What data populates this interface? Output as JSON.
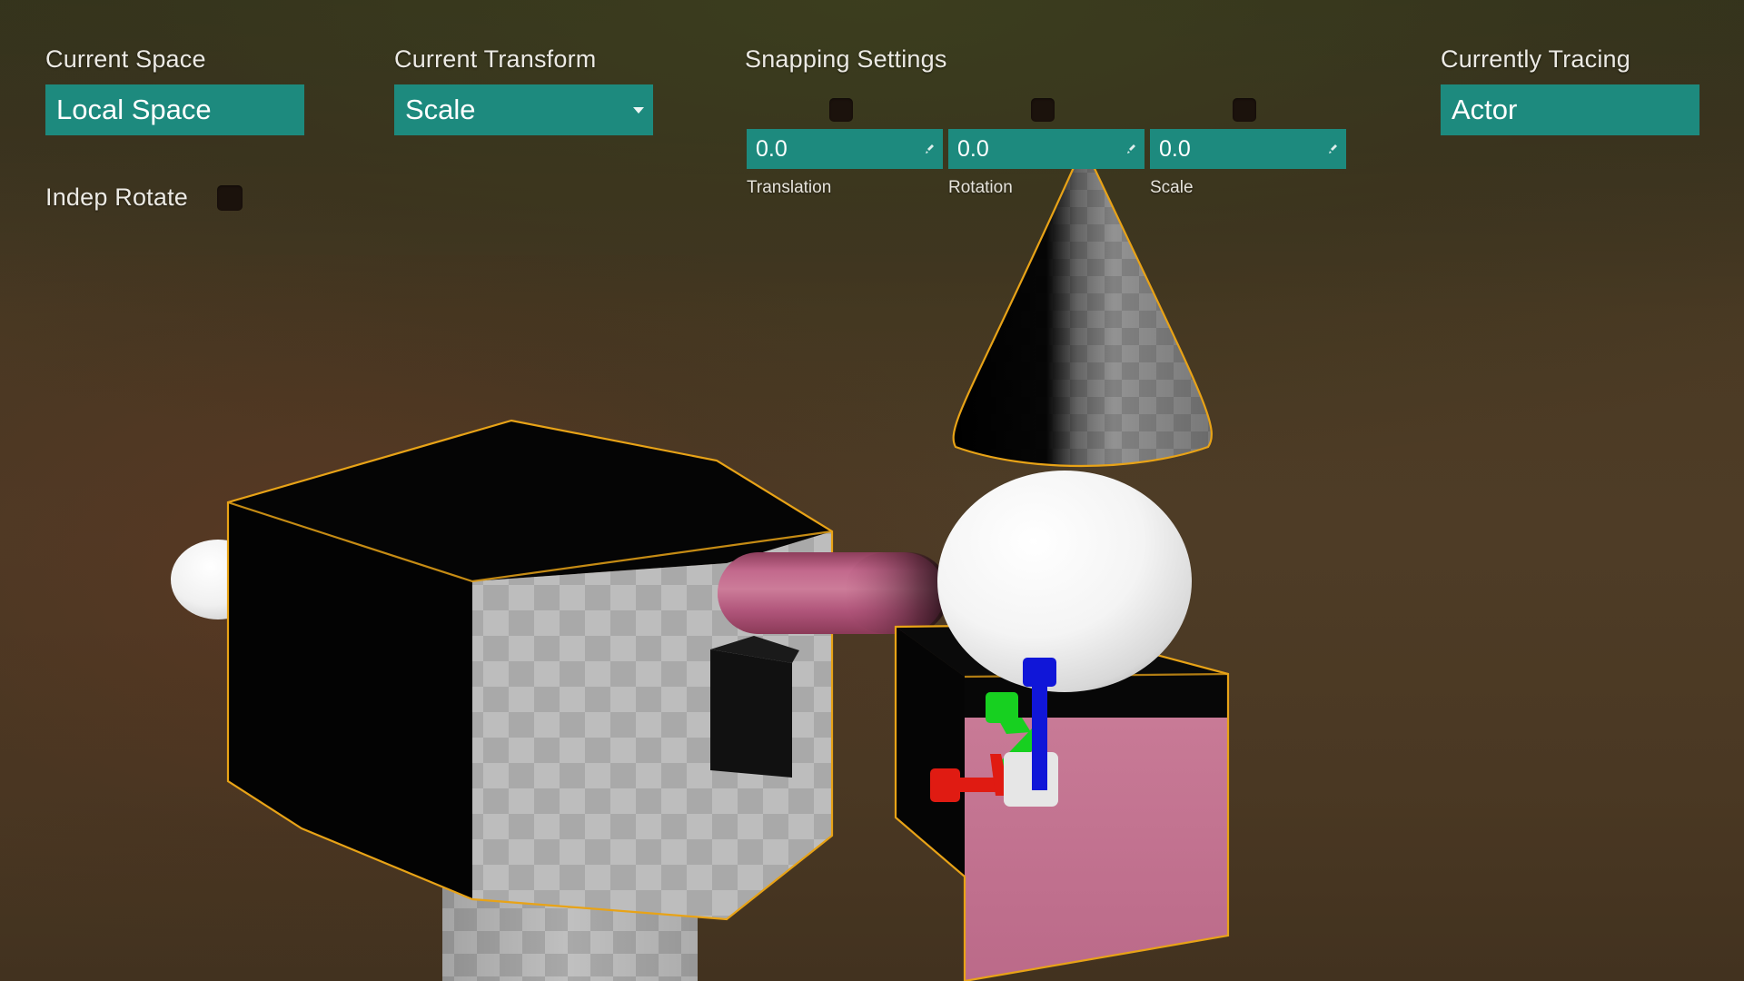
{
  "app": {
    "kind": "3d-viewport-transform-hud"
  },
  "hud": {
    "current_space": {
      "label": "Current Space",
      "value": "Local Space"
    },
    "current_transform": {
      "label": "Current Transform",
      "value": "Scale",
      "dropdown_icon": "chevron-down-icon"
    },
    "indep_rotate": {
      "label": "Indep Rotate",
      "checked": false
    },
    "snapping": {
      "label": "Snapping Settings",
      "fields": [
        {
          "name": "translation",
          "sublabel": "Translation",
          "value": "0.0",
          "checked": false
        },
        {
          "name": "rotation",
          "sublabel": "Rotation",
          "value": "0.0",
          "checked": false
        },
        {
          "name": "scale",
          "sublabel": "Scale",
          "value": "0.0",
          "checked": false
        }
      ]
    },
    "currently_tracing": {
      "label": "Currently Tracing",
      "value": "Actor"
    }
  },
  "colors": {
    "accent_teal": "#1d8a7e",
    "background_brown": "#4a3a24",
    "background_olive": "#32331d",
    "selection_outline": "#e8a317",
    "checkbox_dark": "#1b120c",
    "text_light": "#eceae4",
    "gizmo_x_red": "#e01b12",
    "gizmo_y_green": "#17d020",
    "gizmo_z_blue": "#1016d8",
    "gizmo_center_white": "#e8e8e8",
    "capsule_pink": "#b5537a",
    "cube_pink": "#c4718f",
    "sphere_white": "#f2f2f2",
    "checker_light": "#cfcfcf",
    "checker_dark": "#b4b4b4"
  },
  "scene": {
    "objects": [
      {
        "name": "cone",
        "material": "checker-gray",
        "selected": true
      },
      {
        "name": "sphere",
        "material": "white",
        "selected": false
      },
      {
        "name": "pink-cube",
        "material": "pink",
        "selected": true
      },
      {
        "name": "checkered-cube",
        "material": "checker-gray",
        "selected": true
      },
      {
        "name": "pink-capsule",
        "material": "pink",
        "selected": false
      },
      {
        "name": "small-sphere",
        "material": "white",
        "selected": false
      },
      {
        "name": "blue-marker",
        "material": "blue",
        "selected": false
      },
      {
        "name": "checkered-pillar",
        "material": "checker-gray",
        "selected": true
      }
    ],
    "gizmo": {
      "type": "scale-gizmo",
      "axes": [
        "x",
        "y",
        "z"
      ]
    }
  }
}
